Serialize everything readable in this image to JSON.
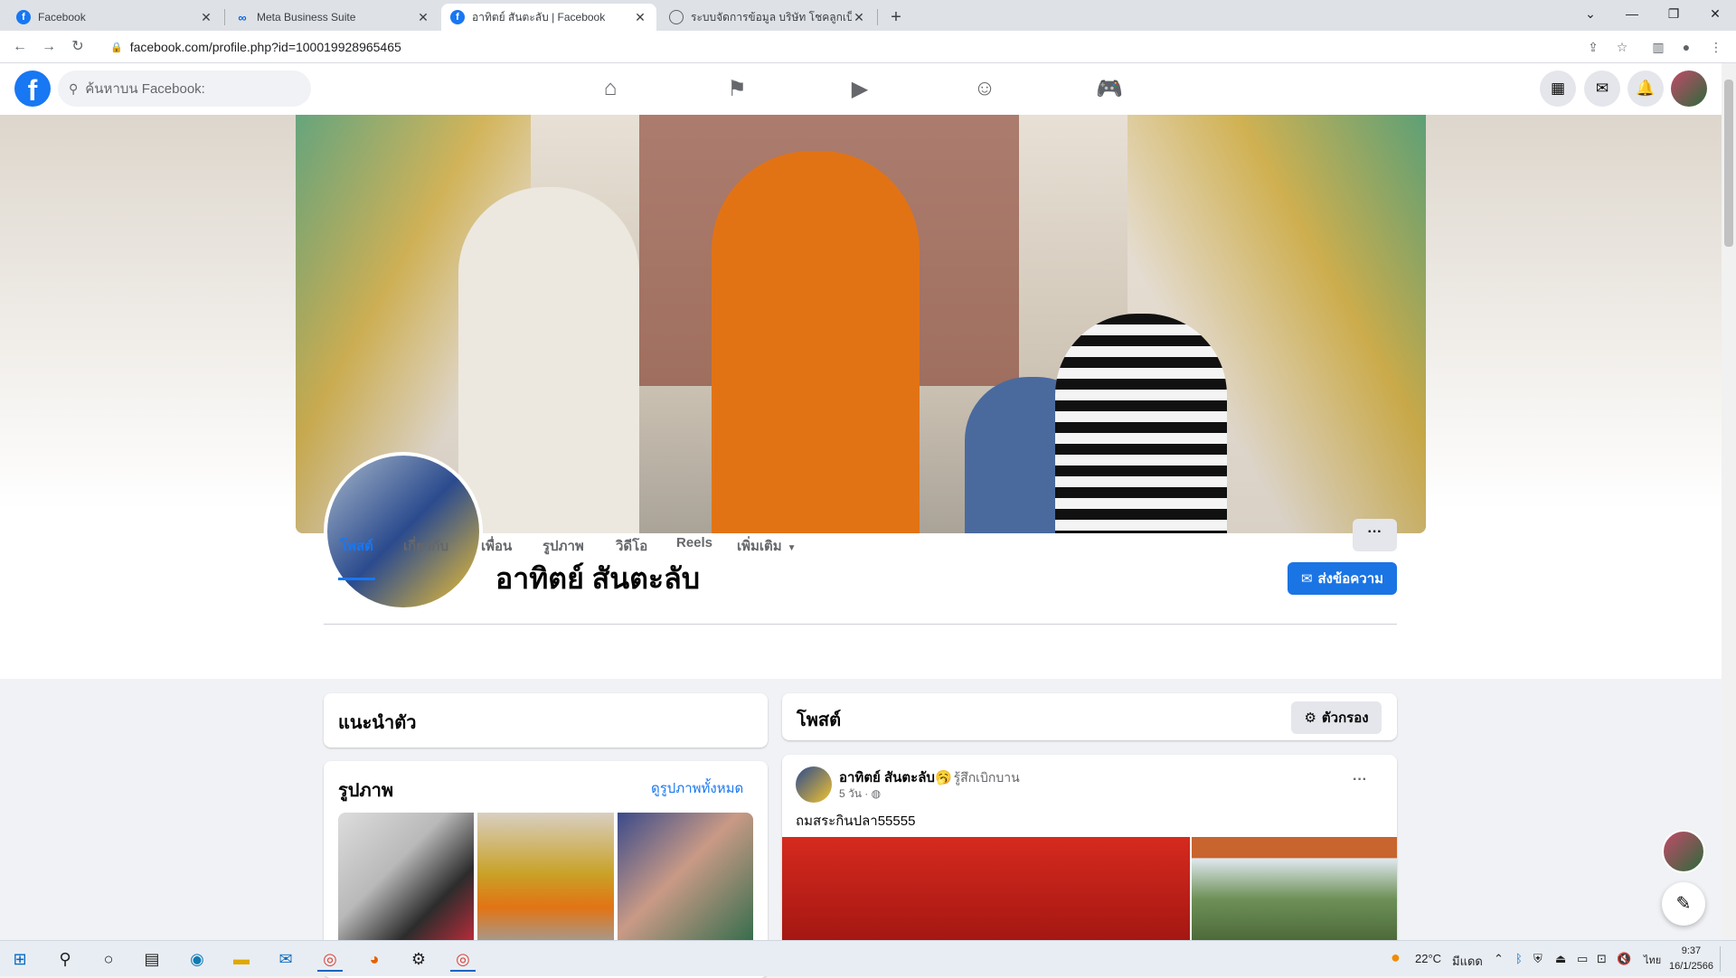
{
  "browser": {
    "tabs": [
      {
        "title": "Facebook",
        "favicon": "facebook-favicon",
        "active": false
      },
      {
        "title": "Meta Business Suite",
        "favicon": "meta-favicon",
        "active": false
      },
      {
        "title": "อาทิตย์ สันตะลับ | Facebook",
        "favicon": "facebook-favicon",
        "active": true
      },
      {
        "title": "ระบบจัดการข้อมูล บริษัท โชคลูกเบ็ด จ...",
        "favicon": "globe-favicon",
        "active": false
      }
    ],
    "close_glyph": "✕",
    "new_tab_glyph": "+",
    "address": "facebook.com/profile.php?id=100019928965465"
  },
  "fb_nav": {
    "logo_letter": "f",
    "search_placeholder": "ค้นหาบน Facebook:"
  },
  "profile": {
    "name": "อาทิตย์ สันตะลับ",
    "message_button": "ส่งข้อความ",
    "tabs": [
      "โพสต์",
      "เกี่ยวกับ",
      "เพื่อน",
      "รูปภาพ",
      "วิดีโอ",
      "Reels",
      "เพิ่มเติม"
    ],
    "more_glyph": "···"
  },
  "intro_card": {
    "title": "แนะนำตัว"
  },
  "photos_card": {
    "title": "รูปภาพ",
    "see_all": "ดูรูปภาพทั้งหมด"
  },
  "posts_card": {
    "title": "โพสต์",
    "filter_label": "ตัวกรอง"
  },
  "post": {
    "author": "อาทิตย์ สันตะลับ",
    "emoji": "🥱",
    "feeling": "รู้สึกเบิกบาน",
    "time": "5 วัน ·",
    "text": "ถมสระกินปลา55555",
    "menu_glyph": "···"
  },
  "taskbar": {
    "weather": "22°C",
    "weather_desc": "มีแดด",
    "lang": "ไทย",
    "time": "9:37",
    "date": "16/1/2566"
  },
  "colors": {
    "fb_blue": "#1877f2",
    "button_blue": "#1b74e4"
  }
}
